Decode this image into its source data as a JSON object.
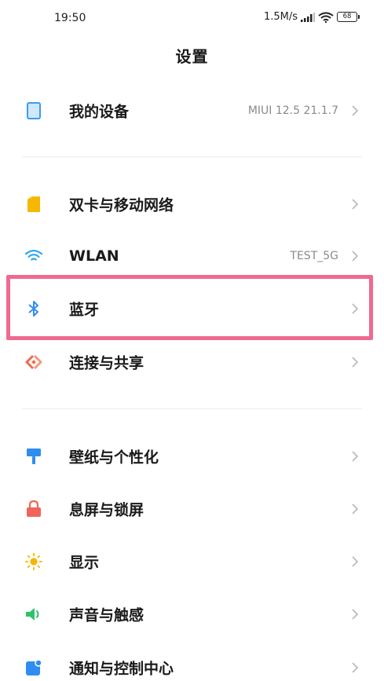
{
  "status": {
    "time": "19:50",
    "speed": "1.5M/s",
    "battery": "68"
  },
  "header": {
    "title": "设置"
  },
  "sections": {
    "device": [
      {
        "label": "我的设备",
        "value": "MIUI 12.5 21.1.7",
        "icon": "device-icon",
        "color": "#3e9af0"
      }
    ],
    "network": [
      {
        "label": "双卡与移动网络",
        "value": "",
        "icon": "sim-icon",
        "color": "#f5b800"
      },
      {
        "label": "WLAN",
        "value": "TEST_5G",
        "icon": "wifi-icon",
        "color": "#2fa7f3"
      },
      {
        "label": "蓝牙",
        "value": "",
        "icon": "bluetooth-icon",
        "color": "#2f8df0"
      },
      {
        "label": "连接与共享",
        "value": "",
        "icon": "share-icon",
        "color": "#ef6a4f"
      }
    ],
    "personal": [
      {
        "label": "壁纸与个性化",
        "value": "",
        "icon": "wallpaper-icon",
        "color": "#2f8df0"
      },
      {
        "label": "息屏与锁屏",
        "value": "",
        "icon": "lock-icon",
        "color": "#f0645a"
      },
      {
        "label": "显示",
        "value": "",
        "icon": "sun-icon",
        "color": "#f7b500"
      },
      {
        "label": "声音与触感",
        "value": "",
        "icon": "speaker-icon",
        "color": "#2fc26a"
      },
      {
        "label": "通知与控制中心",
        "value": "",
        "icon": "notification-icon",
        "color": "#2f8df0"
      }
    ]
  },
  "highlight_color": "#ee6a90"
}
